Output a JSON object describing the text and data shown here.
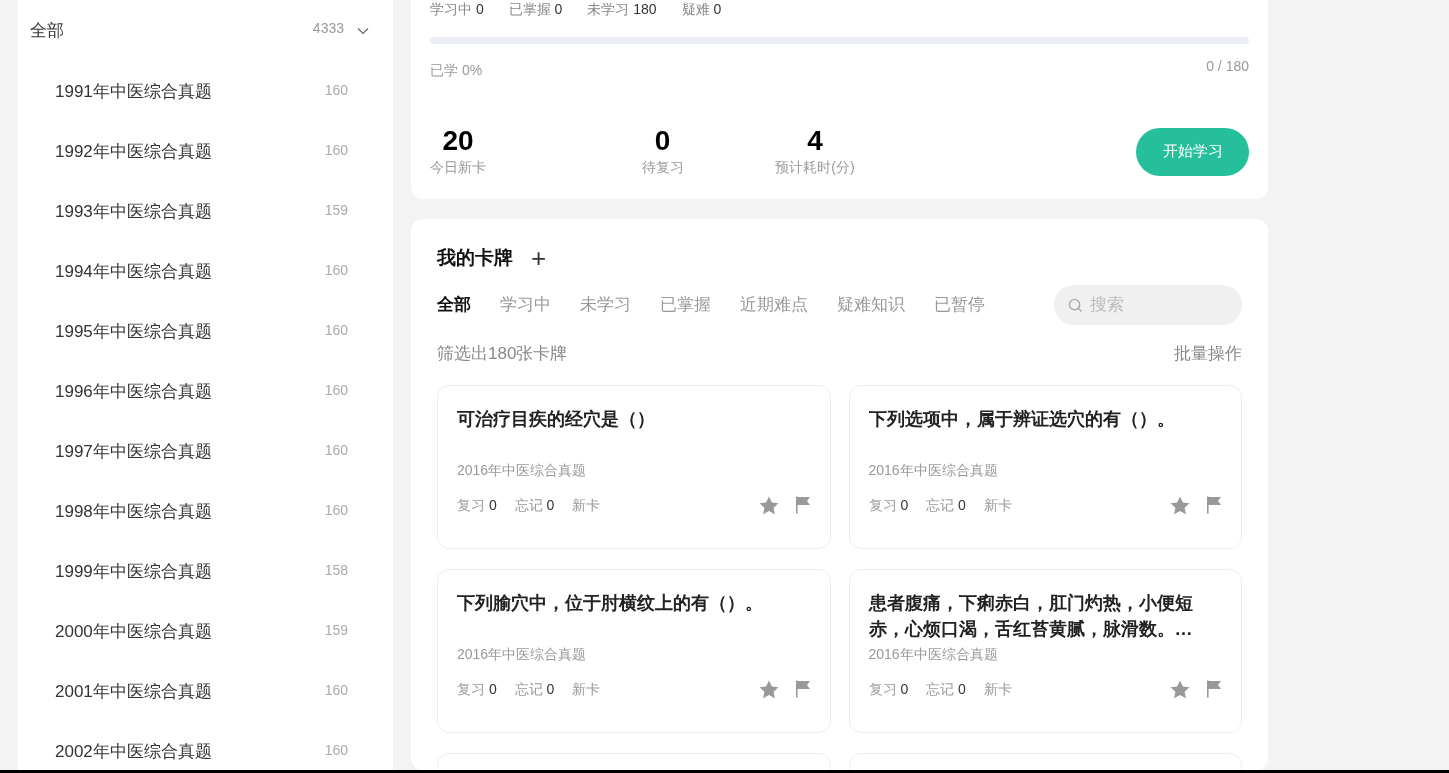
{
  "sidebar": {
    "root": {
      "label": "全部",
      "count": "4333",
      "expanded": true
    },
    "items": [
      {
        "label": "1991年中医综合真题",
        "count": "160"
      },
      {
        "label": "1992年中医综合真题",
        "count": "160"
      },
      {
        "label": "1993年中医综合真题",
        "count": "159"
      },
      {
        "label": "1994年中医综合真题",
        "count": "160"
      },
      {
        "label": "1995年中医综合真题",
        "count": "160"
      },
      {
        "label": "1996年中医综合真题",
        "count": "160"
      },
      {
        "label": "1997年中医综合真题",
        "count": "160"
      },
      {
        "label": "1998年中医综合真题",
        "count": "160"
      },
      {
        "label": "1999年中医综合真题",
        "count": "158"
      },
      {
        "label": "2000年中医综合真题",
        "count": "159"
      },
      {
        "label": "2001年中医综合真题",
        "count": "160"
      },
      {
        "label": "2002年中医综合真题",
        "count": "160"
      }
    ]
  },
  "overview": {
    "counts": [
      {
        "label": "学习中",
        "value": "0"
      },
      {
        "label": "已掌握",
        "value": "0"
      },
      {
        "label": "未学习",
        "value": "180"
      },
      {
        "label": "疑难",
        "value": "0"
      }
    ],
    "progress": {
      "level": 0,
      "label": "已学 0%",
      "reading": "0 / 180"
    },
    "stats": [
      {
        "value": "20",
        "label": "今日新卡"
      },
      {
        "value": "0",
        "label": "待复习"
      },
      {
        "value": "4",
        "label": "预计耗时(分)"
      }
    ],
    "start_button": "开始学习"
  },
  "deck": {
    "title": "我的卡牌",
    "add_icon": "+",
    "tabs": [
      {
        "label": "全部",
        "selected": true
      },
      {
        "label": "学习中",
        "selected": false
      },
      {
        "label": "未学习",
        "selected": false
      },
      {
        "label": "已掌握",
        "selected": false
      },
      {
        "label": "近期难点",
        "selected": false
      },
      {
        "label": "疑难知识",
        "selected": false
      },
      {
        "label": "已暂停",
        "selected": false
      }
    ],
    "search": {
      "placeholder": "搜索"
    },
    "filter_summary": "筛选出180张卡牌",
    "batch_action": "批量操作",
    "cards": [
      {
        "question": "可治疗目疾的经穴是（）",
        "source": "2016年中医综合真题",
        "review_label": "复习",
        "review": "0",
        "forget_label": "忘记",
        "forget": "0",
        "status": "新卡"
      },
      {
        "question": "下列选项中，属于辨证选穴的有（）。",
        "source": "2016年中医综合真题",
        "review_label": "复习",
        "review": "0",
        "forget_label": "忘记",
        "forget": "0",
        "status": "新卡"
      },
      {
        "question": "下列腧穴中，位于肘横纹上的有（）。",
        "source": "2016年中医综合真题",
        "review_label": "复习",
        "review": "0",
        "forget_label": "忘记",
        "forget": "0",
        "status": "新卡"
      },
      {
        "question": "患者腹痛，下痢赤白，肛门灼热，小便短赤，心烦口渴，舌红苔黄腻，脉滑数。…",
        "source": "2016年中医综合真题",
        "review_label": "复习",
        "review": "0",
        "forget_label": "忘记",
        "forget": "0",
        "status": "新卡"
      }
    ]
  }
}
